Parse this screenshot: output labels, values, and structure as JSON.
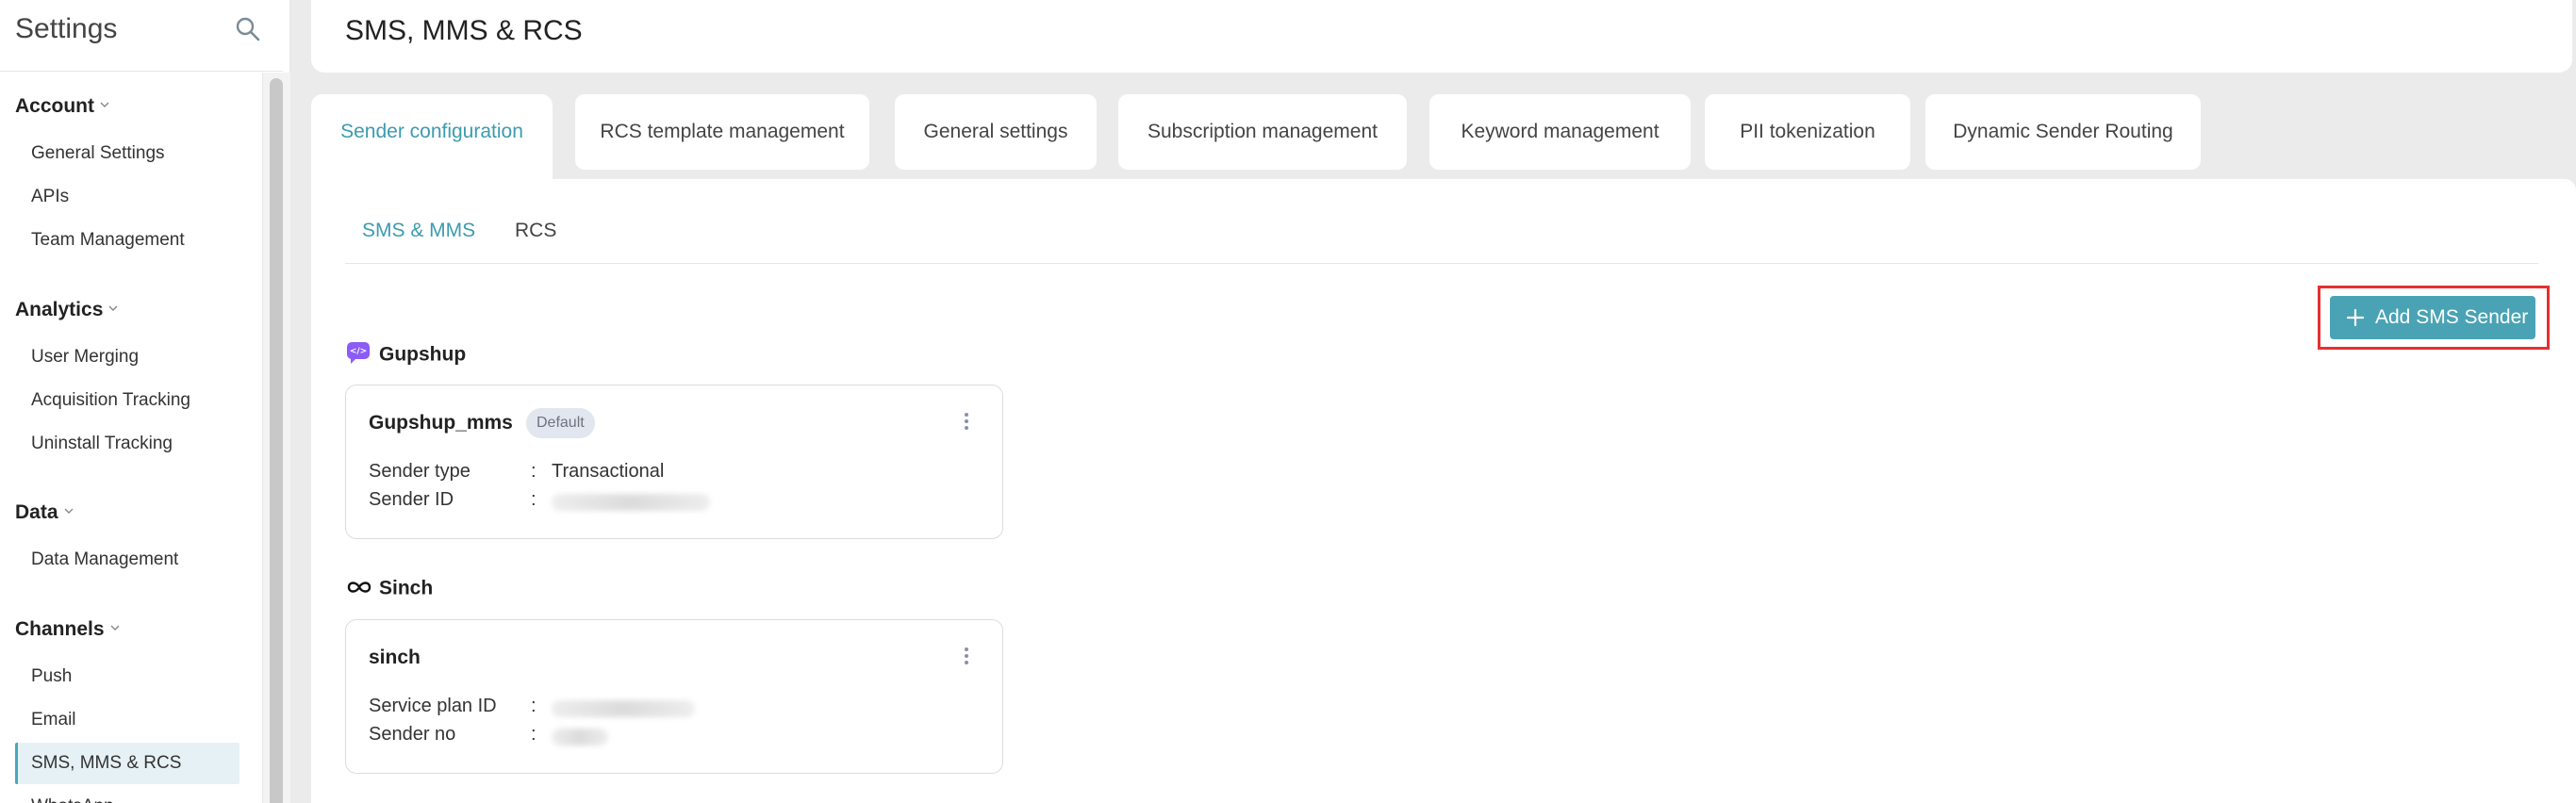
{
  "sidebar": {
    "title": "Settings",
    "sections": [
      {
        "label": "Account",
        "items": [
          "General Settings",
          "APIs",
          "Team Management"
        ]
      },
      {
        "label": "Analytics",
        "items": [
          "User Merging",
          "Acquisition Tracking",
          "Uninstall Tracking"
        ]
      },
      {
        "label": "Data",
        "items": [
          "Data Management"
        ]
      },
      {
        "label": "Channels",
        "items": [
          "Push",
          "Email",
          "SMS, MMS & RCS",
          "WhatsApp"
        ]
      }
    ]
  },
  "header": {
    "title": "SMS, MMS & RCS"
  },
  "tabs": [
    "Sender configuration",
    "RCS template management",
    "General settings",
    "Subscription management",
    "Keyword management",
    "PII tokenization",
    "Dynamic Sender Routing"
  ],
  "subtabs": [
    "SMS & MMS",
    "RCS"
  ],
  "add_button": {
    "label": "Add SMS Sender"
  },
  "providers": [
    {
      "name": "Gupshup",
      "card": {
        "title": "Gupshup_mms",
        "badge": "Default",
        "fields": [
          {
            "label": "Sender type",
            "value": "Transactional"
          },
          {
            "label": "Sender ID",
            "value": ""
          }
        ]
      }
    },
    {
      "name": "Sinch",
      "card": {
        "title": "sinch",
        "fields": [
          {
            "label": "Service plan ID",
            "value": ""
          },
          {
            "label": "Sender no",
            "value": ""
          }
        ]
      }
    }
  ],
  "colors": {
    "accent": "#4aa3b5",
    "highlight_outline": "#e53030",
    "active_item_bg": "#e6f1f5"
  }
}
